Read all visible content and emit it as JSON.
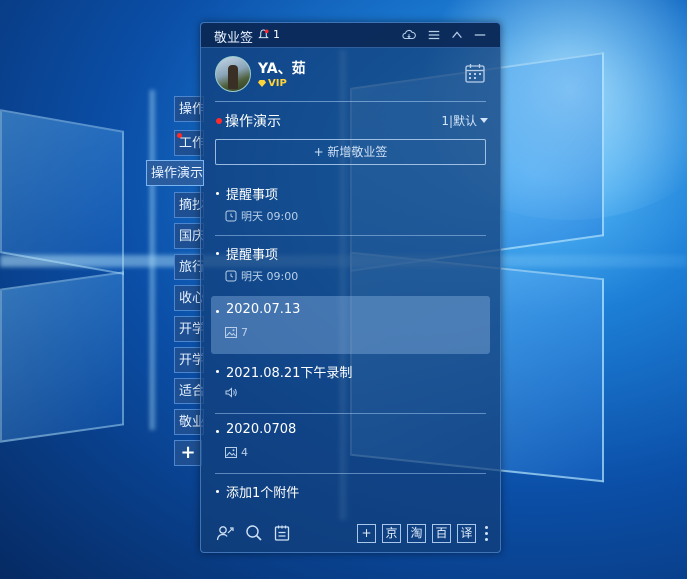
{
  "app": {
    "title": "敬业签",
    "notification_count": "1"
  },
  "user": {
    "name": "YA、茹",
    "badge": "VIP"
  },
  "section": {
    "title": "操作演示",
    "sort_label": "1|默认"
  },
  "new_note_label": "+ 新增敬业签",
  "side_tabs": [
    {
      "label": "操作"
    },
    {
      "label": "工作"
    },
    {
      "label": "操作演示"
    },
    {
      "label": "摘抄"
    },
    {
      "label": "国庆"
    },
    {
      "label": "旅行"
    },
    {
      "label": "收心"
    },
    {
      "label": "开学"
    },
    {
      "label": "开学"
    },
    {
      "label": "适合"
    },
    {
      "label": "敬业"
    }
  ],
  "side_add_label": "+",
  "notes": [
    {
      "title": "提醒事项",
      "meta": "明天  09:00",
      "meta_icon": "repeat-clock-icon"
    },
    {
      "title": "提醒事项",
      "meta": "明天  09:00",
      "meta_icon": "repeat-clock-icon"
    },
    {
      "title": "2020.07.13",
      "meta": "7",
      "meta_icon": "image-icon"
    },
    {
      "title": "2021.08.21下午录制",
      "meta": "",
      "meta_icon": "speaker-icon"
    },
    {
      "title": "2020.0708",
      "meta": "4",
      "meta_icon": "image-icon"
    },
    {
      "title": "添加1个附件",
      "meta": "",
      "meta_icon": ""
    }
  ],
  "bottom_buttons": [
    {
      "label": "+"
    },
    {
      "label": "京"
    },
    {
      "label": "淘"
    },
    {
      "label": "百"
    },
    {
      "label": "译"
    }
  ],
  "colors": {
    "accent_red": "#ff2a2a",
    "vip_gold": "#ffd33a",
    "panel_bg": "#123e78"
  }
}
